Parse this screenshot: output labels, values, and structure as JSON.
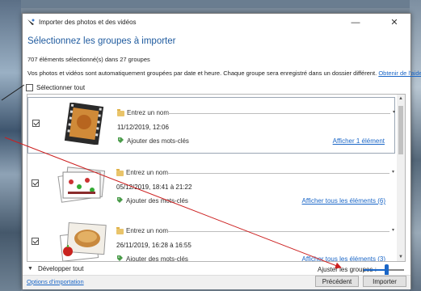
{
  "window": {
    "title": "Importer des photos et des vidéos",
    "minimize": "—",
    "close": "✕"
  },
  "heading": "Sélectionnez les groupes à importer",
  "count_text": "707 éléments sélectionné(s) dans 27 groupes",
  "info_text": "Vos photos et vidéos sont automatiquement groupées par date et heure. Chaque groupe sera enregistré dans un dossier différent.",
  "help_link": "Obtenir de l'aide",
  "select_all": "Sélectionner tout",
  "groups": [
    {
      "name_placeholder": "Entrez un nom",
      "date": "11/12/2019, 12:06",
      "tags": "Ajouter des mots-clés",
      "show": "Afficher 1 élément",
      "checked": true
    },
    {
      "name_placeholder": "Entrez un nom",
      "date": "05/12/2019, 18:41 à 21:22",
      "tags": "Ajouter des mots-clés",
      "show": "Afficher tous les éléments (6)",
      "checked": true
    },
    {
      "name_placeholder": "Entrez un nom",
      "date": "26/11/2019, 16:28 à 16:55",
      "tags": "Ajouter des mots-clés",
      "show": "Afficher tous les éléments (3)",
      "checked": true
    }
  ],
  "expand_all": "Développer tout",
  "adjust_groups": "Ajuster les groupes :",
  "slider_value": 0.55,
  "import_options": "Options d'importation",
  "buttons": {
    "previous": "Précédent",
    "import": "Importer"
  },
  "colors": {
    "accent": "#1a66c7",
    "heading": "#1e5a9e",
    "annotation_arrow": "#cc1f1f"
  },
  "icons": [
    "app-icon",
    "folder-icon",
    "tag-icon",
    "chevron-down-icon",
    "checkbox-icon"
  ]
}
